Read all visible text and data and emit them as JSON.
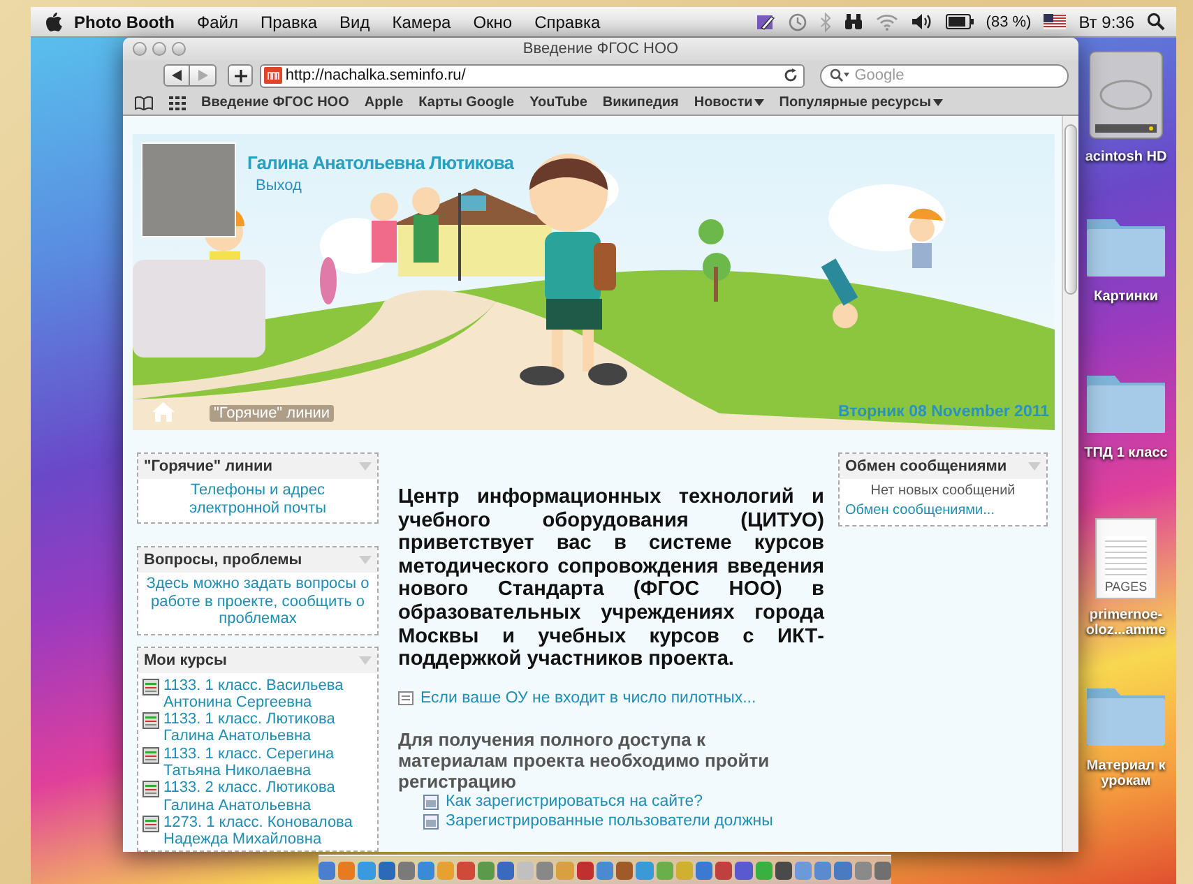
{
  "menu_bar": {
    "app_name": "Photo Booth",
    "menus": [
      "Файл",
      "Правка",
      "Вид",
      "Камера",
      "Окно",
      "Справка"
    ],
    "battery": "(83 %)",
    "clock": "Вт 9:36"
  },
  "desktop_icons": [
    {
      "kind": "drive",
      "lines": [
        "acintosh HD"
      ]
    },
    {
      "kind": "folder",
      "lines": [
        "Картинки"
      ]
    },
    {
      "kind": "folder",
      "lines": [
        "ТПД 1 класс"
      ]
    },
    {
      "kind": "document",
      "badge": "PAGES",
      "lines": [
        "primernoe-",
        "oloz...amme"
      ]
    },
    {
      "kind": "folder",
      "lines": [
        "Материал к",
        "урокам"
      ]
    }
  ],
  "window": {
    "title": "Введение ФГОС НОО",
    "url": "http://nachalka.seminfo.ru/",
    "search_placeholder": "Google",
    "bookmarks": [
      {
        "label": "Введение ФГОС НОО",
        "has_menu": false
      },
      {
        "label": "Apple",
        "has_menu": false
      },
      {
        "label": "Карты Google",
        "has_menu": false
      },
      {
        "label": "YouTube",
        "has_menu": false
      },
      {
        "label": "Википедия",
        "has_menu": false
      },
      {
        "label": "Новости",
        "has_menu": true
      },
      {
        "label": "Популярные ресурсы",
        "has_menu": true
      }
    ],
    "page": {
      "header": {
        "user_name": "Галина Анатольевна Лютикова",
        "logout": "Выход",
        "nav_link": "\"Горячие\" линии",
        "date": "Вторник 08 November 2011"
      },
      "left_blocks": [
        {
          "kind": "text",
          "title": "\"Горячие\" линии",
          "text": "Телефоны и адрес электронной почты"
        },
        {
          "kind": "text",
          "title": "Вопросы, проблемы",
          "text": "Здесь можно задать вопросы о работе в проекте, сообщить о проблемах"
        },
        {
          "kind": "courses",
          "title": "Мои курсы",
          "items": [
            "1133. 1 класс. Васильева Антонина Сергеевна",
            "1133. 1 класс. Лютикова Галина Анатольевна",
            "1133. 1 класс. Серегина Татьяна Николаевна",
            "1133. 2 класс. Лютикова Галина Анатольевна",
            "1273. 1 класс. Коновалова Надежда Михайловна"
          ]
        }
      ],
      "intro": "Центр информационных технологий и учебного оборудования (ЦИТУО) приветствует вас в системе курсов методического сопровождения введения нового Стандарта (ФГОС НОО) в образовательных учреждениях города Москвы и учебных курсов с ИКТ-поддержкой участников проекта.",
      "pilot_link": "Если ваше ОУ не входит в число пилотных...",
      "registration_heading": "Для получения полного доступа к материалам проекта необходимо пройти регистрацию",
      "registration_links": [
        "Как зарегистрироваться на сайте?",
        "Зарегистрированные пользователи должны"
      ],
      "messages": {
        "title": "Обмен сообщениями",
        "status": "Нет новых сообщений",
        "link": "Обмен сообщениями..."
      }
    }
  }
}
